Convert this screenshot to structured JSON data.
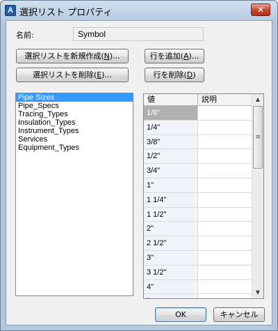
{
  "window": {
    "title": "選択リスト プロパティ",
    "close_label": "✕",
    "app_icon_letter": "A"
  },
  "name": {
    "label": "名前:",
    "value": "Symbol"
  },
  "buttons": {
    "new_list": {
      "text": "選択リストを新規作成(",
      "key": "N",
      "suffix": ")..."
    },
    "delete_list": {
      "text": "選択リストを削除(",
      "key": "E",
      "suffix": ")..."
    },
    "add_row": {
      "text": "行を追加(",
      "key": "A",
      "suffix": ")..."
    },
    "delete_row": {
      "text": "行を削除(",
      "key": "D",
      "suffix": ")"
    },
    "ok": "OK",
    "cancel": "キャンセル"
  },
  "lists": [
    {
      "label": "Pipe Sizes",
      "selected": true
    },
    {
      "label": "Pipe_Specs"
    },
    {
      "label": "Tracing_Types"
    },
    {
      "label": "Insulation_Types"
    },
    {
      "label": "Instrument_Types"
    },
    {
      "label": "Services"
    },
    {
      "label": "Equipment_Types"
    }
  ],
  "grid": {
    "columns": [
      "値",
      "説明"
    ],
    "rows": [
      {
        "value": "1/8\"",
        "desc": ""
      },
      {
        "value": "1/4\"",
        "desc": ""
      },
      {
        "value": "3/8\"",
        "desc": ""
      },
      {
        "value": "1/2\"",
        "desc": ""
      },
      {
        "value": "3/4\"",
        "desc": ""
      },
      {
        "value": "1\"",
        "desc": ""
      },
      {
        "value": "1 1/4\"",
        "desc": ""
      },
      {
        "value": "1 1/2\"",
        "desc": ""
      },
      {
        "value": "2\"",
        "desc": ""
      },
      {
        "value": "2 1/2\"",
        "desc": ""
      },
      {
        "value": "3\"",
        "desc": ""
      },
      {
        "value": "3 1/2\"",
        "desc": ""
      },
      {
        "value": "4\"",
        "desc": ""
      },
      {
        "value": "\"",
        "desc": ""
      }
    ],
    "scroll_up": "▲",
    "scroll_down": "▼",
    "scroll_grip": "≡"
  }
}
